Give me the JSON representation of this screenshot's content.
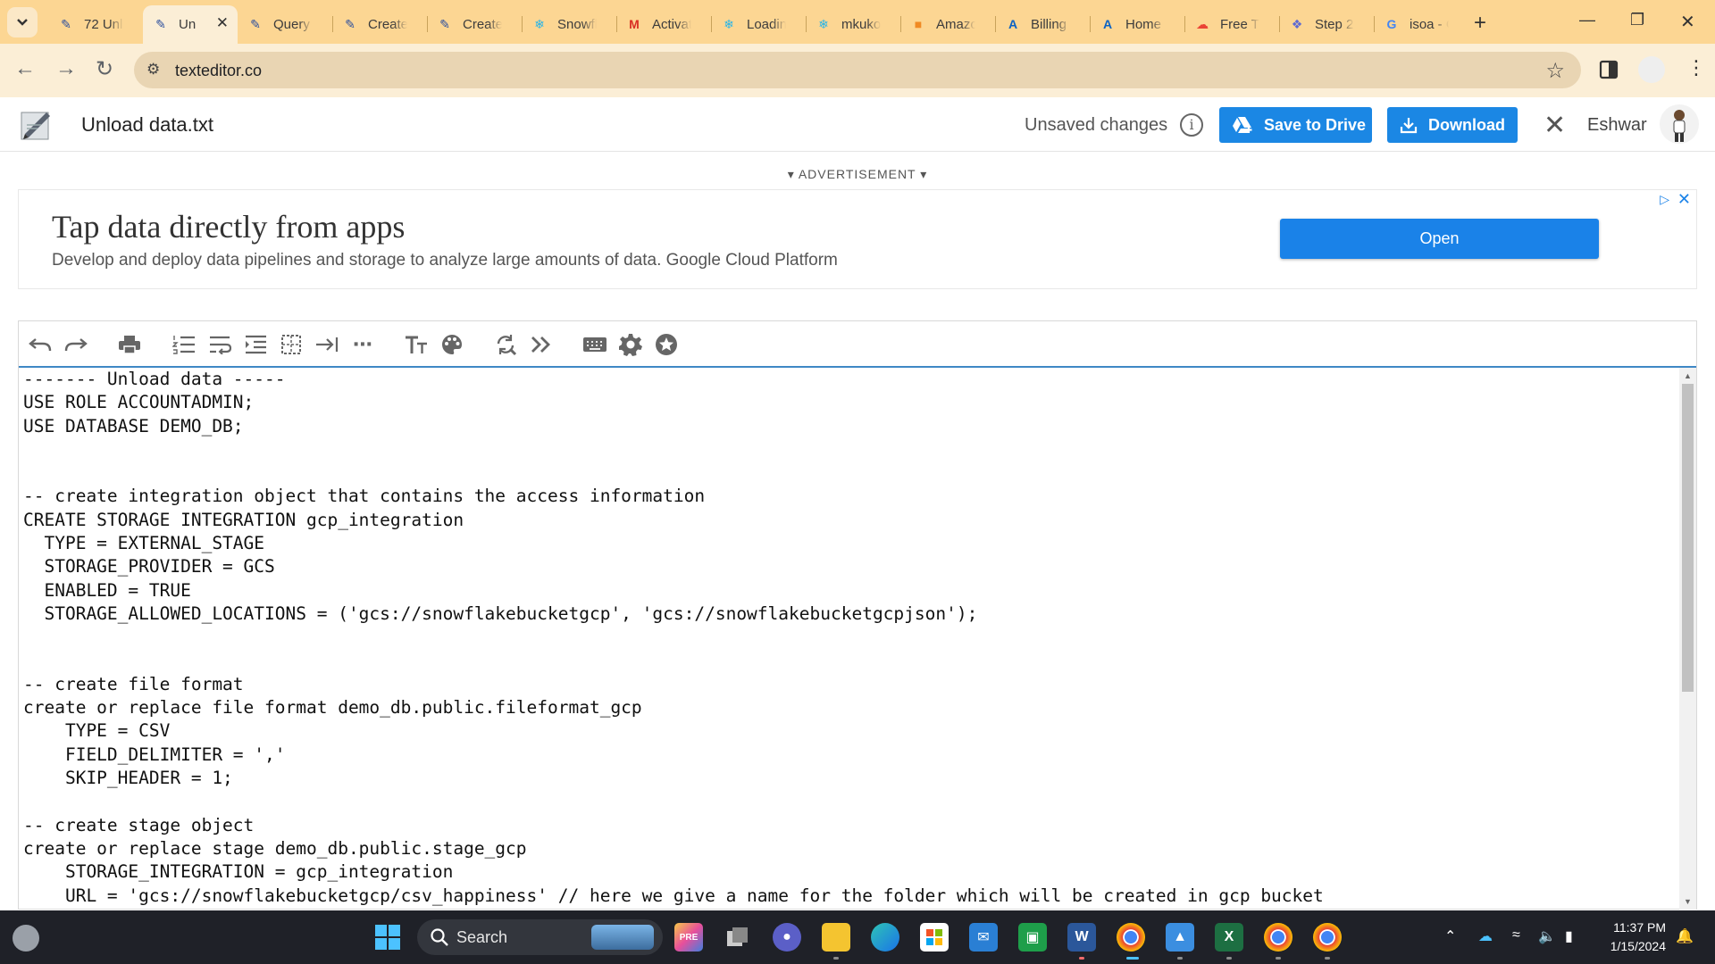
{
  "browser": {
    "tabs": [
      {
        "title": "72 Unl",
        "icon": "pen-icon",
        "active": false
      },
      {
        "title": "Un",
        "icon": "pen-icon",
        "active": true
      },
      {
        "title": "Query",
        "icon": "pen-icon",
        "active": false
      },
      {
        "title": "Create",
        "icon": "pen-icon",
        "active": false
      },
      {
        "title": "Create",
        "icon": "pen-icon",
        "active": false
      },
      {
        "title": "Snowfl",
        "icon": "snowflake-icon",
        "active": false
      },
      {
        "title": "Activat",
        "icon": "gmail-icon",
        "active": false
      },
      {
        "title": "Loadin",
        "icon": "snowflake-icon",
        "active": false
      },
      {
        "title": "mkuko",
        "icon": "snowflake-icon",
        "active": false
      },
      {
        "title": "Amazo",
        "icon": "box-icon",
        "active": false
      },
      {
        "title": "Billing",
        "icon": "azure-icon",
        "active": false
      },
      {
        "title": "Home",
        "icon": "azure-icon",
        "active": false
      },
      {
        "title": "Free Tr",
        "icon": "cloud-icon",
        "active": false
      },
      {
        "title": "Step 2",
        "icon": "puzzle-icon",
        "active": false
      },
      {
        "title": "isoa - C",
        "icon": "google-icon",
        "active": false
      }
    ],
    "url": "texteditor.co"
  },
  "header": {
    "filename": "Unload data.txt",
    "unsaved": "Unsaved changes",
    "save_to_drive": "Save to Drive",
    "download": "Download",
    "user": "Eshwar"
  },
  "ad": {
    "label": "▾ ADVERTISEMENT ▾",
    "title": "Tap data directly from apps",
    "description": "Develop and deploy data pipelines and storage to analyze large amounts of data. Google Cloud Platform",
    "cta": "Open"
  },
  "editor": {
    "lines": [
      "------- Unload data -----",
      "USE ROLE ACCOUNTADMIN;",
      "USE DATABASE DEMO_DB;",
      "",
      "",
      "-- create integration object that contains the access information",
      "CREATE STORAGE INTEGRATION gcp_integration",
      "  TYPE = EXTERNAL_STAGE",
      "  STORAGE_PROVIDER = GCS",
      "  ENABLED = TRUE",
      "  STORAGE_ALLOWED_LOCATIONS = ('gcs://snowflakebucketgcp', 'gcs://snowflakebucketgcpjson');",
      "",
      "",
      "-- create file format",
      "create or replace file format demo_db.public.fileformat_gcp",
      "    TYPE = CSV",
      "    FIELD_DELIMITER = ','",
      "    SKIP_HEADER = 1;",
      "",
      "-- create stage object",
      "create or replace stage demo_db.public.stage_gcp",
      "    STORAGE_INTEGRATION = gcp_integration",
      "    URL = 'gcs://snowflakebucketgcp/csv_happiness' // here we give a name for the folder which will be created in gcp bucket"
    ]
  },
  "taskbar": {
    "search": "Search",
    "time": "11:37 PM",
    "date": "1/15/2024"
  }
}
